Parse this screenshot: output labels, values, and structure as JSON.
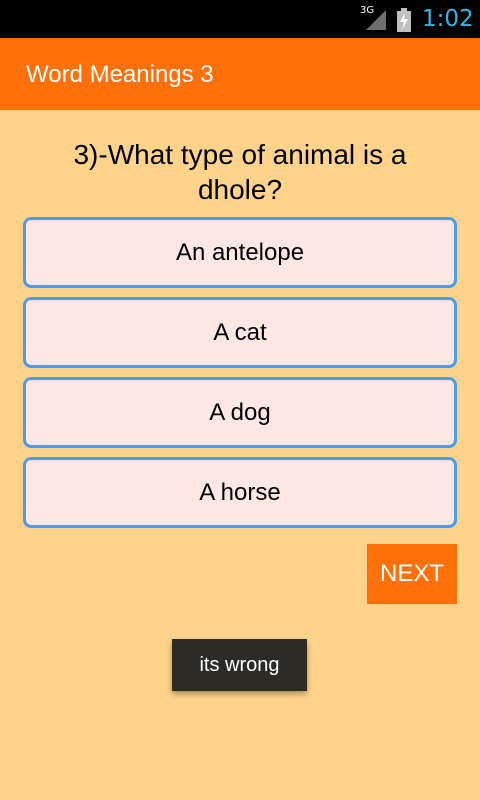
{
  "status_bar": {
    "network_label": "3G",
    "time": "1:02",
    "signal_icon": "signal-icon",
    "battery_icon": "battery-charging-icon",
    "time_color": "#33B5E5"
  },
  "action_bar": {
    "title": "Word Meanings 3",
    "color": "#FF7009"
  },
  "question": {
    "text": "3)-What type of animal is a dhole?"
  },
  "answers": [
    {
      "label": "An antelope"
    },
    {
      "label": "A cat"
    },
    {
      "label": "A dog"
    },
    {
      "label": "A horse"
    }
  ],
  "next_button": {
    "label": "NEXT"
  },
  "toast": {
    "message": "its wrong"
  },
  "colors": {
    "background": "#FFD48A",
    "answer_fill": "#FFE8E4",
    "answer_border": "#4A9BEA",
    "toast_bg": "#2C2B26"
  }
}
